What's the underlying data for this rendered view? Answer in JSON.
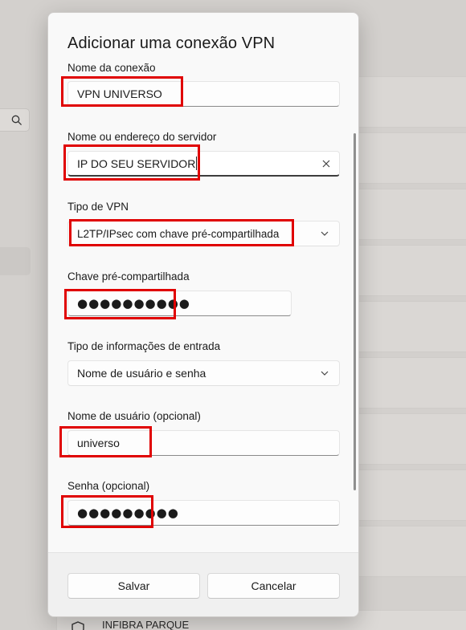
{
  "background": {
    "bottom_item": {
      "title": "INFIBRA PARQUE"
    }
  },
  "dialog": {
    "title": "Adicionar uma conexão VPN",
    "fields": {
      "connection_name": {
        "label": "Nome da conexão",
        "value": "VPN UNIVERSO"
      },
      "server": {
        "label": "Nome ou endereço do servidor",
        "value": "IP DO SEU SERVIDOR"
      },
      "vpn_type": {
        "label": "Tipo de VPN",
        "value": "L2TP/IPsec com chave pré-compartilhada"
      },
      "preshared_key": {
        "label": "Chave pré-compartilhada",
        "value": "●●●●●●●●●●"
      },
      "signin_type": {
        "label": "Tipo de informações de entrada",
        "value": "Nome de usuário e senha"
      },
      "username": {
        "label": "Nome de usuário (opcional)",
        "value": "universo"
      },
      "password": {
        "label": "Senha (opcional)",
        "value": "●●●●●●●●●"
      }
    },
    "buttons": {
      "save": "Salvar",
      "cancel": "Cancelar"
    }
  },
  "annotations": {
    "highlight_color": "#e00000"
  },
  "icons": [
    "search-icon",
    "clear-icon",
    "chevron-down-icon",
    "shield-icon"
  ]
}
